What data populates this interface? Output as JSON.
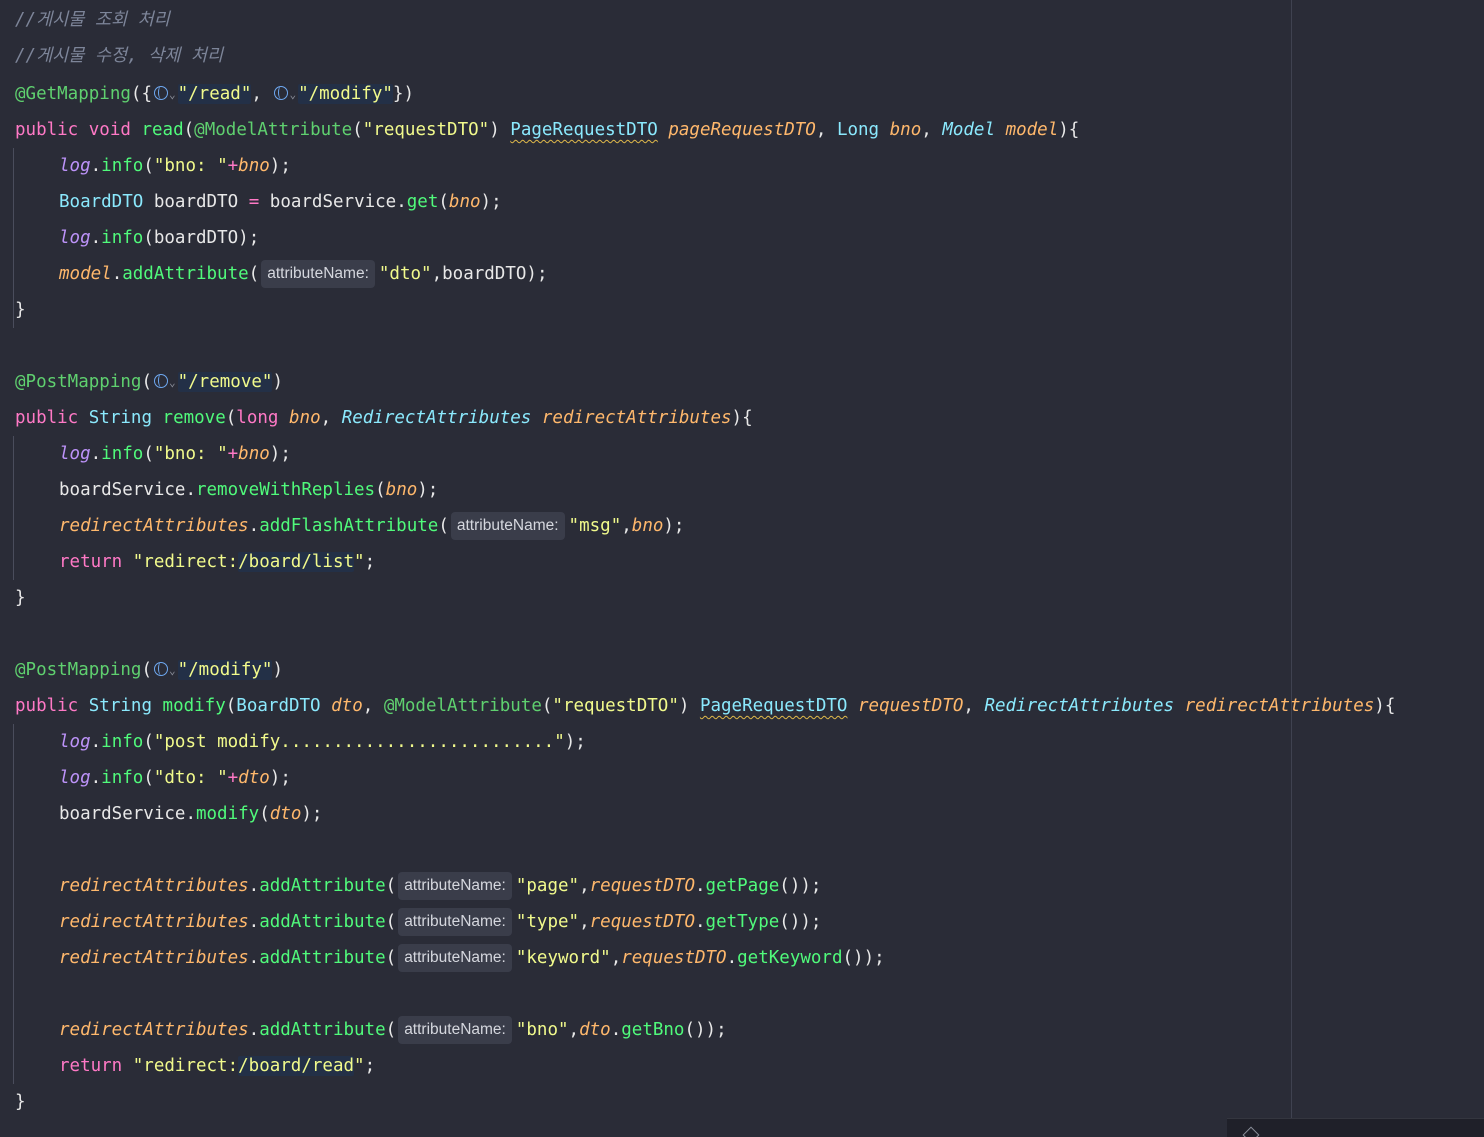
{
  "comments": {
    "c1": "//게시물 조회 처리",
    "c2": "//게시물 수정, 삭제 처리"
  },
  "hint_label": "attributeName:",
  "tokens": {
    "get_mapping": "@GetMapping",
    "post_mapping": "@PostMapping",
    "model_attribute": "@ModelAttribute",
    "public": "public",
    "void": "void",
    "string_type": "String",
    "long_boxed": "Long",
    "long_prim": "long",
    "return": "return",
    "read": "read",
    "remove": "remove",
    "modify": "modify",
    "page_request_dto": "PageRequestDTO",
    "board_dto": "BoardDTO",
    "model_type": "Model",
    "redirect_attributes_type": "RedirectAttributes",
    "log": "log",
    "info": "info",
    "board_service": "boardService",
    "get": "get",
    "remove_with_replies": "removeWithReplies",
    "model_var": "model",
    "add_attribute": "addAttribute",
    "add_flash_attribute": "addFlashAttribute",
    "page_request_dto_param": "pageRequestDTO",
    "bno": "bno",
    "board_dto_var": "boardDTO",
    "redirect_attributes_param": "redirectAttributes",
    "dto_param": "dto",
    "request_dto_param": "requestDTO",
    "get_page": "getPage",
    "get_type": "getType",
    "get_keyword": "getKeyword",
    "get_bno": "getBno"
  },
  "strings": {
    "read_url": "\"/read\"",
    "modify_url": "\"/modify\"",
    "remove_url": "\"/remove\"",
    "request_dto": "\"requestDTO\"",
    "bno_prefix": "\"bno: \"",
    "dto_key": "\"dto\"",
    "msg_key": "\"msg\"",
    "redirect_prefix": "\"redirect:",
    "board_list": "/board/list",
    "board_read": "/board/read",
    "quote_end": "\"",
    "post_modify": "\"post modify..........................\"",
    "dto_prefix": "\"dto: \"",
    "page_key": "\"page\"",
    "type_key": "\"type\"",
    "keyword_key": "\"keyword\"",
    "bno_key": "\"bno\""
  },
  "icons": {
    "url_mapping": "globe-icon",
    "mapping_dropdown": "chevron-down-icon",
    "panel_toggle": "diamond-icon"
  }
}
